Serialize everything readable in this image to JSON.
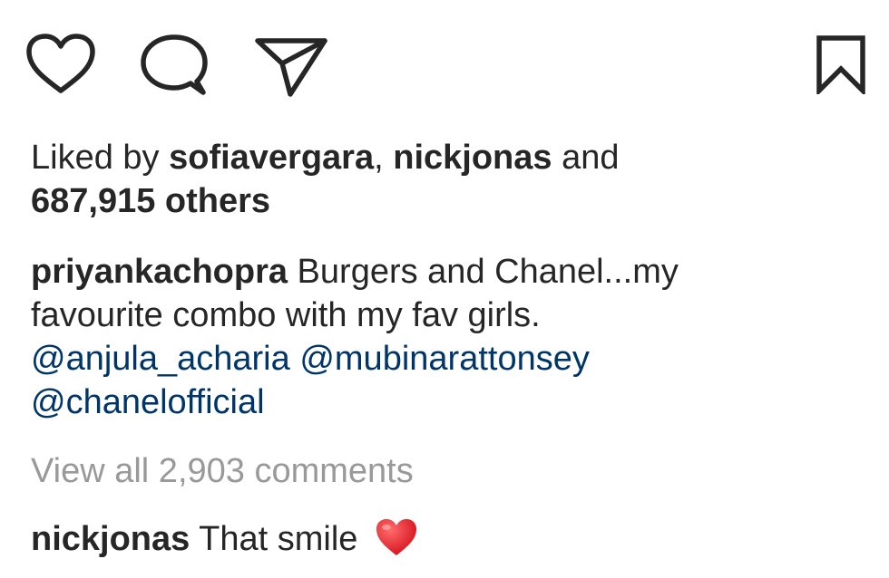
{
  "actions": {
    "like_icon": "heart-outline-icon",
    "comment_icon": "speech-bubble-icon",
    "share_icon": "paper-plane-icon",
    "save_icon": "bookmark-icon"
  },
  "likes": {
    "prefix": "Liked by ",
    "user1": "sofiavergara",
    "separator": ", ",
    "user2": "nickjonas",
    "conjunction": " and",
    "others": "687,915 others"
  },
  "caption": {
    "username": "priyankachopra",
    "text_line1": " Burgers and Chanel...my",
    "text_line2": "favourite combo with my fav girls.",
    "mention1": "@anjula_acharia",
    "mention2": "@mubinarattonsey",
    "mention3": "@chanelofficial"
  },
  "comments": {
    "view_all_label": "View all 2,903 comments",
    "items": [
      {
        "username": "nickjonas",
        "text": " That smile ",
        "emoji_icon": "red-heart-icon"
      }
    ]
  },
  "colors": {
    "text": "#262626",
    "link": "#003569",
    "muted": "#999999",
    "heart": "#e0202c"
  }
}
